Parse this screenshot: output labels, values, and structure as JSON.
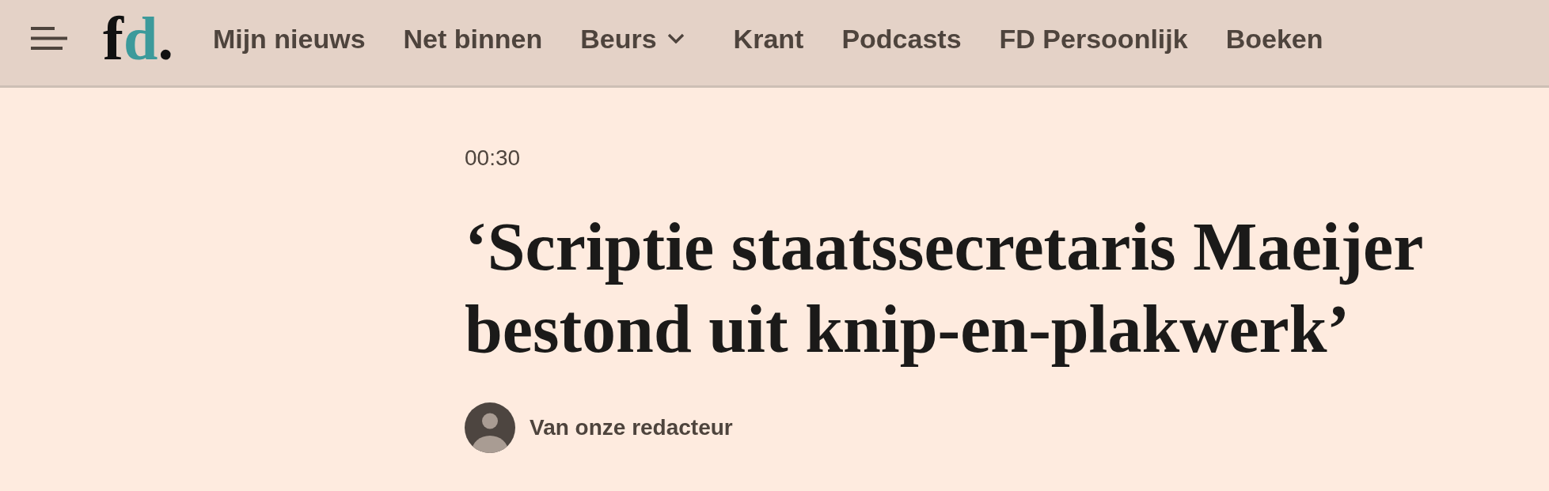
{
  "header": {
    "logo": {
      "parts": [
        {
          "text": "f",
          "color": "#111111"
        },
        {
          "text": "d",
          "color": "#3c9a9b"
        },
        {
          "text": ".",
          "color": "#111111"
        }
      ]
    },
    "nav": [
      {
        "label": "Mijn nieuws",
        "dropdown": false
      },
      {
        "label": "Net binnen",
        "dropdown": false
      },
      {
        "label": "Beurs",
        "dropdown": true
      },
      {
        "label": "Krant",
        "dropdown": false
      },
      {
        "label": "Podcasts",
        "dropdown": false
      },
      {
        "label": "FD Persoonlijk",
        "dropdown": false
      },
      {
        "label": "Boeken",
        "dropdown": false
      }
    ]
  },
  "article": {
    "time": "00:30",
    "headline": "‘Scriptie staatssecretaris Maeijer bestond uit knip-en-plakwerk’",
    "byline": "Van onze redacteur"
  }
}
